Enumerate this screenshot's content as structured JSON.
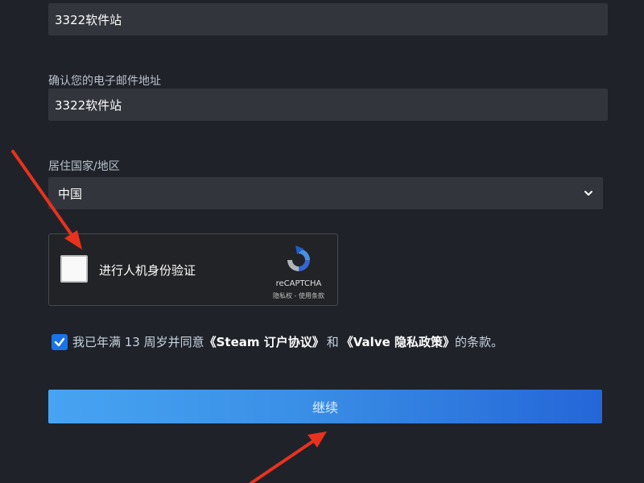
{
  "form": {
    "email_value": "3322软件站",
    "confirm_email_label": "确认您的电子邮件地址",
    "confirm_email_value": "3322软件站",
    "country_label": "居住国家/地区",
    "country_value": "中国"
  },
  "captcha": {
    "label": "进行人机身份验证",
    "brand": "reCAPTCHA",
    "links": "隐私权 - 使用条款"
  },
  "agreement": {
    "prefix": "我已年满 13 周岁并同意",
    "steam_link": "《Steam 订户协议》",
    "middle": "和",
    "valve_link": "《Valve 隐私政策》",
    "suffix": "的条款。"
  },
  "actions": {
    "continue_label": "继续"
  },
  "colors": {
    "background": "#1f2229",
    "field": "#32353c",
    "accent": "#1a73e8",
    "arrow": "#e8321e"
  }
}
